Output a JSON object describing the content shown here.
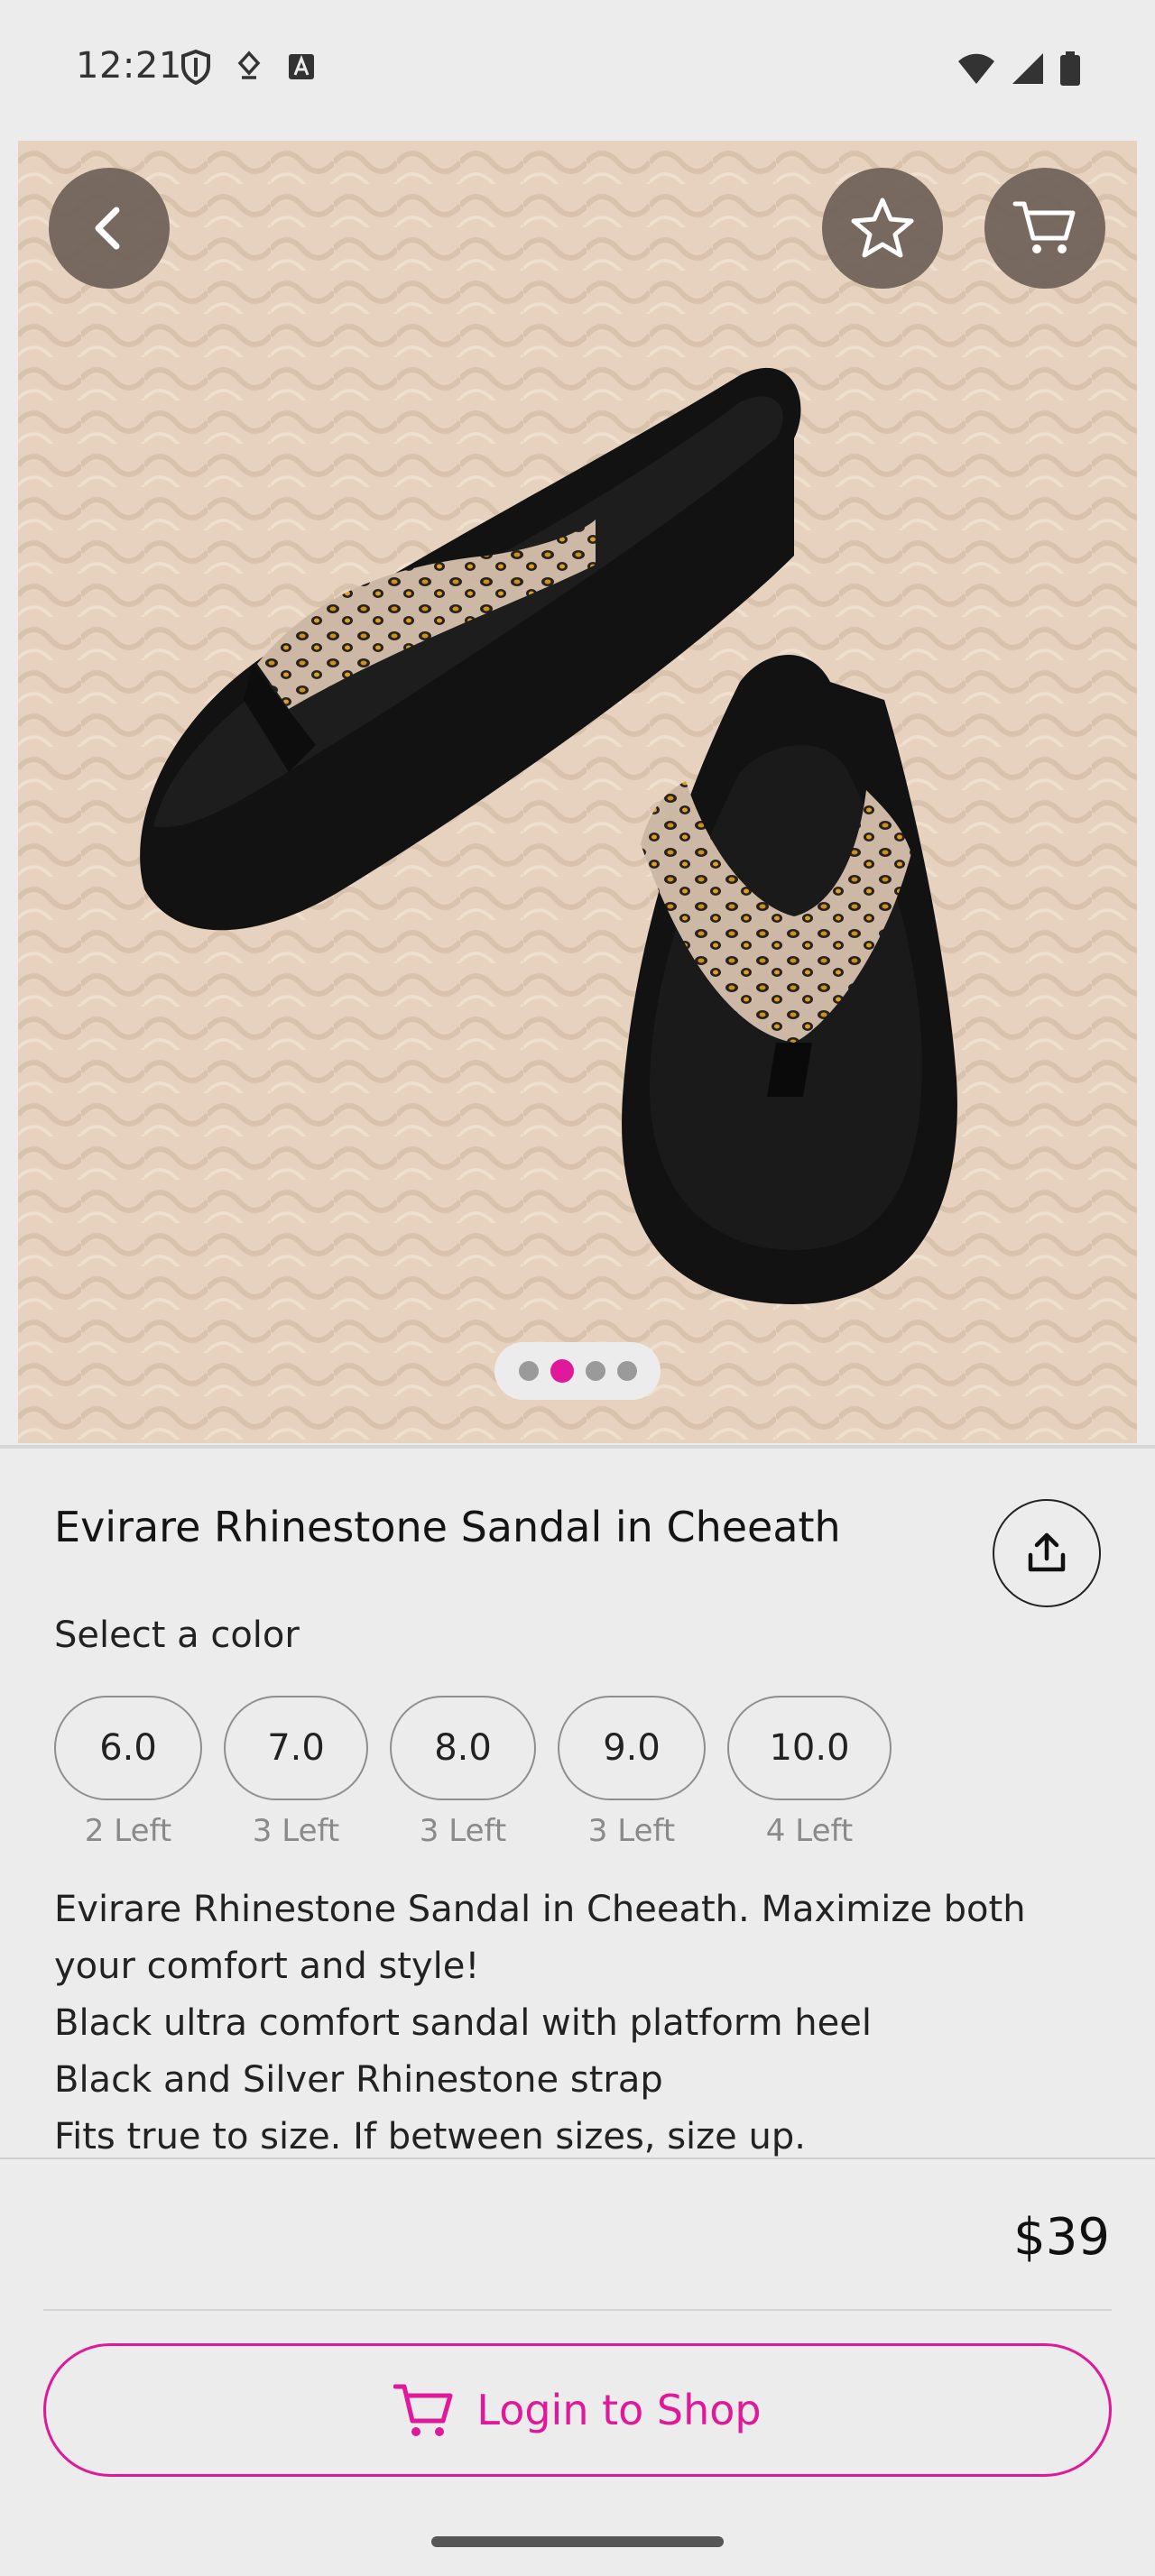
{
  "status_bar": {
    "time": "12:21"
  },
  "hero": {
    "slide_count": 4,
    "active_slide": 2
  },
  "product": {
    "title": "Evirare Rhinestone Sandal in Cheeath",
    "select_label": "Select a color",
    "sizes": [
      {
        "label": "6.0",
        "stock": "2 Left"
      },
      {
        "label": "7.0",
        "stock": "3 Left"
      },
      {
        "label": "8.0",
        "stock": "3 Left"
      },
      {
        "label": "9.0",
        "stock": "3 Left"
      },
      {
        "label": "10.0",
        "stock": "4 Left"
      }
    ],
    "description": [
      "Evirare Rhinestone Sandal in Cheeath. Maximize both your comfort and style!",
      "Black ultra comfort sandal with platform heel",
      "Black and Silver Rhinestone strap",
      "Fits true to size. If between sizes, size up."
    ],
    "price": "$39"
  },
  "actions": {
    "login_label": "Login to Shop"
  },
  "icons": {
    "back": "chevron-left-icon",
    "favorite": "star-icon",
    "cart": "cart-icon",
    "share": "share-icon"
  },
  "colors": {
    "accent": "#e0199a",
    "overlay_button": "#6e6058",
    "background": "#ececec"
  }
}
